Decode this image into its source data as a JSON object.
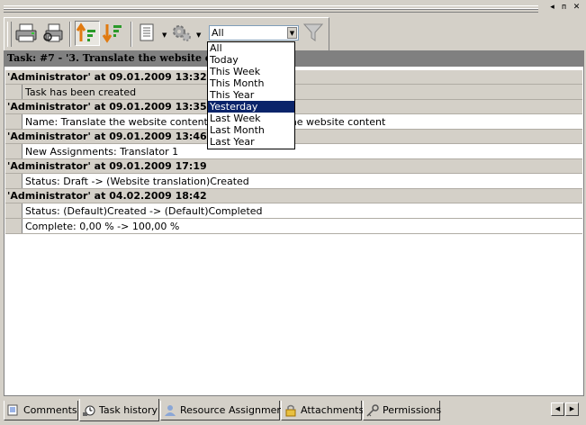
{
  "window": {
    "pin_label": "ᴨ",
    "close_label": "✕",
    "menu_label": "◂"
  },
  "toolbar": {
    "filter": {
      "value": "All"
    }
  },
  "task": {
    "title": "Task: #7 - '3. Translate the website content'"
  },
  "history": [
    {
      "header": "'Administrator' at 09.01.2009 13:32",
      "items": [
        "Task has been created"
      ]
    },
    {
      "header": "'Administrator' at 09.01.2009 13:35",
      "items": [
        "Name: Translate the website content -> 3. Translate the website content"
      ]
    },
    {
      "header": "'Administrator' at 09.01.2009 13:46",
      "items": [
        "New Assignments: Translator 1"
      ]
    },
    {
      "header": "'Administrator' at 09.01.2009 17:19",
      "items": [
        "Status: Draft -> (Website translation)Created"
      ]
    },
    {
      "header": "'Administrator' at 04.02.2009 18:42",
      "items": [
        "Status: (Default)Created -> (Default)Completed",
        "Complete: 0,00 % -> 100,00 %"
      ]
    }
  ],
  "dropdown": {
    "options": [
      "All",
      "Today",
      "This Week",
      "This Month",
      "This Year",
      "Yesterday",
      "Last Week",
      "Last Month",
      "Last Year"
    ],
    "selected_index": 5
  },
  "tabs": [
    {
      "label": "Comments",
      "icon": "comments-icon"
    },
    {
      "label": "Task history",
      "icon": "task-history-icon",
      "active": true
    },
    {
      "label": "Resource Assignment",
      "icon": "resource-assignment-icon"
    },
    {
      "label": "Attachments",
      "icon": "attachments-icon"
    },
    {
      "label": "Permissions",
      "icon": "permissions-icon"
    }
  ],
  "nav": {
    "prev_label": "◀",
    "next_label": "▶"
  },
  "colors": {
    "selection": "#0a246a",
    "task_bar": "#808080",
    "face": "#d4d0c8"
  }
}
